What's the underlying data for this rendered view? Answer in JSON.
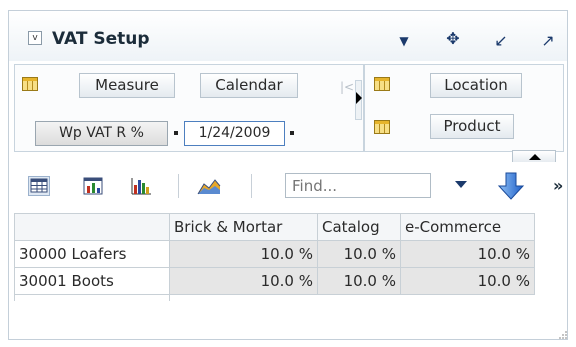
{
  "window": {
    "title": "VAT Setup",
    "collapse_glyph": "v",
    "controls": [
      {
        "name": "dropdown-icon",
        "glyph": "▼"
      },
      {
        "name": "move-icon",
        "glyph": "✥"
      },
      {
        "name": "minimize-icon",
        "glyph": "↙"
      },
      {
        "name": "maximize-icon",
        "glyph": "↗"
      }
    ]
  },
  "dimensions_left": {
    "tiles": [
      "Measure",
      "Calendar"
    ],
    "fixed_measure": "Wp VAT R %",
    "selected_date": "1/24/2009"
  },
  "dimensions_right": {
    "tiles": [
      "Location",
      "Product"
    ]
  },
  "toolbar": {
    "icons": [
      "grid-view-icon",
      "chart-table-icon",
      "bar-chart-icon",
      "area-chart-icon"
    ],
    "find_placeholder": "Find...",
    "more_glyph": "»"
  },
  "table": {
    "columns": [
      "Brick & Mortar",
      "Catalog",
      "e-Commerce"
    ],
    "rows": [
      {
        "label": "30000 Loafers",
        "values": [
          "10.0 %",
          "10.0 %",
          "10.0 %"
        ]
      },
      {
        "label": "30001 Boots",
        "values": [
          "10.0 %",
          "10.0 %",
          "10.0 %"
        ]
      }
    ]
  },
  "colors": {
    "accent_blue": "#2f6fd0",
    "value_cell_bg": "#e6e6e6",
    "border": "#c4cfd9"
  }
}
